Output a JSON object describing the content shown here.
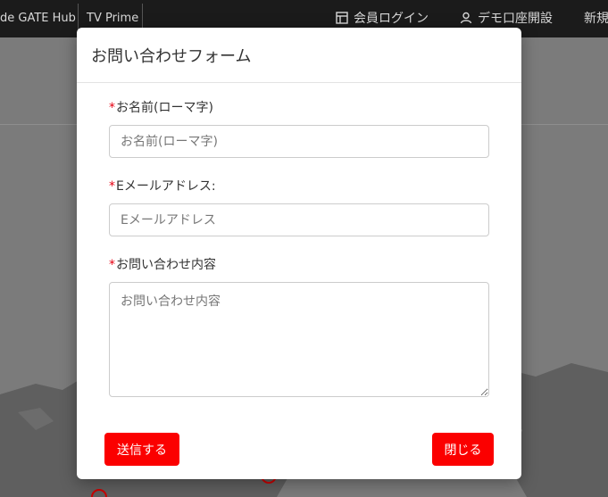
{
  "background": {
    "nav": {
      "items": [
        "de GATE Hub",
        "TV Prime"
      ],
      "right": [
        {
          "label": "会員ログイン",
          "icon": "layout-icon"
        },
        {
          "label": "デモ口座開設",
          "icon": "person-icon"
        },
        {
          "label": "新規"
        }
      ]
    }
  },
  "modal": {
    "title": "お問い合わせフォーム",
    "required_mark": "*",
    "fields": {
      "name": {
        "label": "お名前(ローマ字)",
        "placeholder": "お名前(ローマ字)",
        "value": ""
      },
      "email": {
        "label": "Eメールアドレス:",
        "placeholder": "Eメールアドレス",
        "value": ""
      },
      "message": {
        "label": "お問い合わせ内容",
        "placeholder": "お問い合わせ内容",
        "value": ""
      }
    },
    "submit_label": "送信する",
    "close_label": "閉じる"
  },
  "colors": {
    "accent": "#fb0000",
    "required": "#e60012",
    "header_bg": "#1b1b1b"
  }
}
